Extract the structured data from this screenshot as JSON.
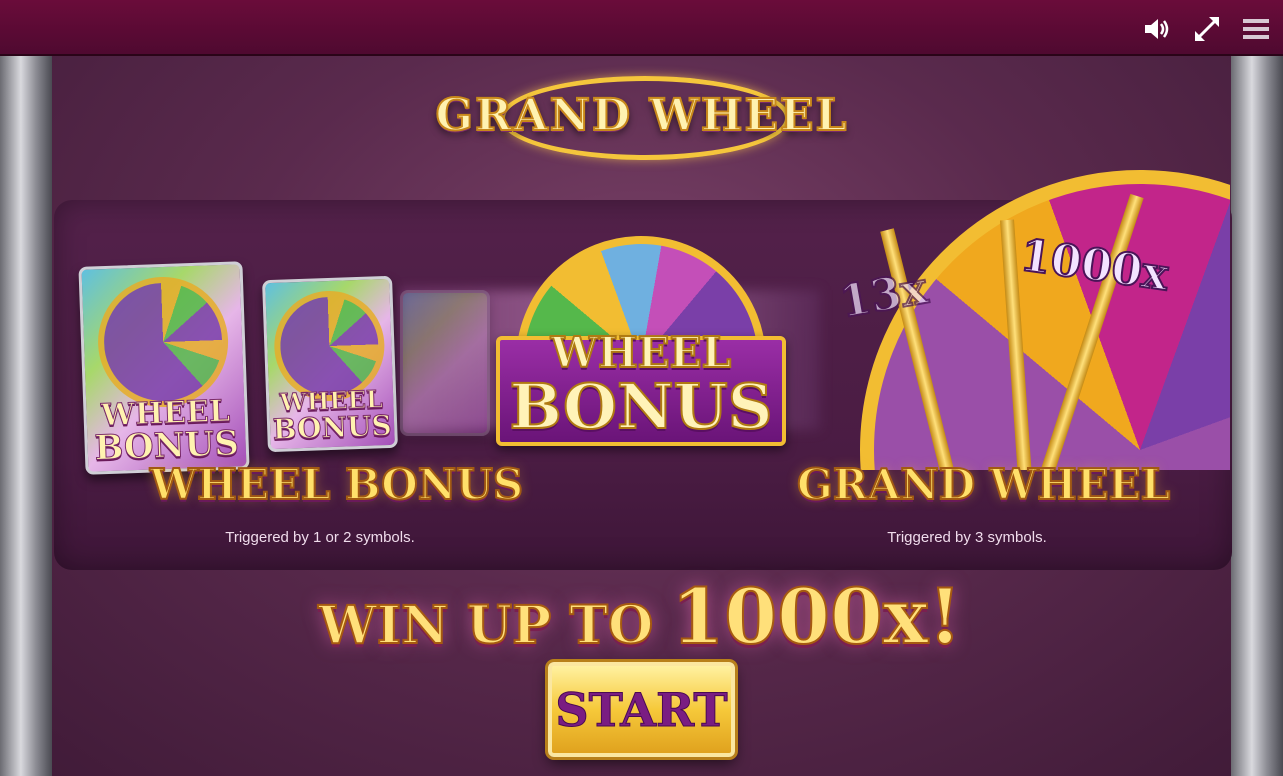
{
  "topbar": {
    "icons": [
      "speaker-icon",
      "fullscreen-icon",
      "menu-icon"
    ]
  },
  "logo": {
    "text": "GRAND WHEEL"
  },
  "symbols": {
    "card_large": {
      "line1": "WHEEL",
      "line2": "BONUS"
    },
    "card_small": {
      "line1": "WHEEL",
      "line2": "BONUS"
    },
    "center": {
      "line1": "WHEEL",
      "line2": "BONUS"
    }
  },
  "big_wheel": {
    "values": [
      "13x",
      "1000x"
    ]
  },
  "features": {
    "left": {
      "title": "WHEEL BONUS",
      "desc": "Triggered by 1 or 2 symbols."
    },
    "right": {
      "title": "GRAND WHEEL",
      "desc": "Triggered by 3 symbols."
    }
  },
  "headline": {
    "prefix": "WIN UP TO ",
    "amount": "1000x!"
  },
  "start_button": {
    "label": "START"
  },
  "colors": {
    "topbar": "#5e0b35",
    "gold": "#f2bd32",
    "purple": "#6a1478"
  }
}
